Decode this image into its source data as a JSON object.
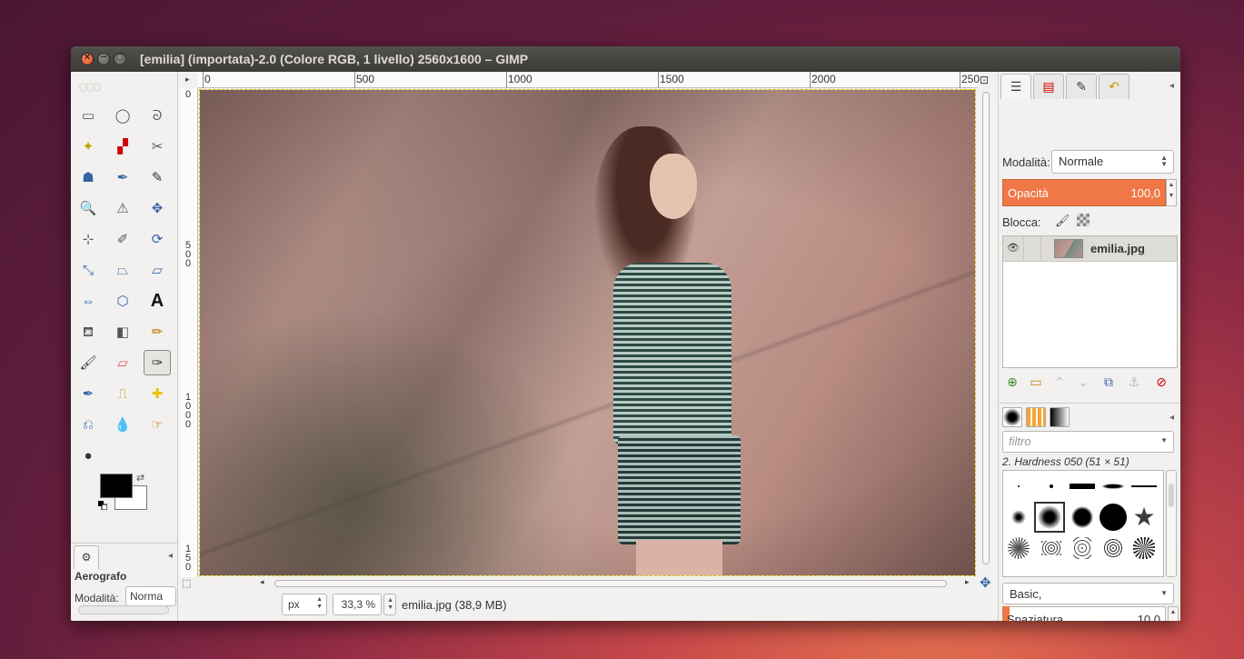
{
  "window": {
    "title": "[emilia] (importata)-2.0 (Colore RGB, 1 livello) 2560x1600 – GIMP"
  },
  "toolbox": {
    "tools": [
      {
        "name": "rect-select-tool",
        "glyph": "▭"
      },
      {
        "name": "ellipse-select-tool",
        "glyph": "◯"
      },
      {
        "name": "free-select-tool",
        "glyph": "ᘐ"
      },
      {
        "name": "fuzzy-select-tool",
        "glyph": "✦"
      },
      {
        "name": "select-by-color-tool",
        "glyph": "▞"
      },
      {
        "name": "scissors-select-tool",
        "glyph": "✂"
      },
      {
        "name": "foreground-select-tool",
        "glyph": "☗"
      },
      {
        "name": "paths-tool",
        "glyph": "✒"
      },
      {
        "name": "color-picker-tool",
        "glyph": "✎"
      },
      {
        "name": "zoom-tool",
        "glyph": "🔍"
      },
      {
        "name": "measure-tool",
        "glyph": "⚠"
      },
      {
        "name": "move-tool",
        "glyph": "✥"
      },
      {
        "name": "align-tool",
        "glyph": "⊹"
      },
      {
        "name": "crop-tool",
        "glyph": "✐"
      },
      {
        "name": "rotate-tool",
        "glyph": "⟳"
      },
      {
        "name": "scale-tool",
        "glyph": "⤡"
      },
      {
        "name": "shear-tool",
        "glyph": "⏢"
      },
      {
        "name": "perspective-tool",
        "glyph": "⏥"
      },
      {
        "name": "flip-tool",
        "glyph": "⇔"
      },
      {
        "name": "cage-transform-tool",
        "glyph": "⬡"
      },
      {
        "name": "text-tool",
        "glyph": "A"
      },
      {
        "name": "bucket-fill-tool",
        "glyph": "⛾"
      },
      {
        "name": "blend-tool",
        "glyph": "◧"
      },
      {
        "name": "pencil-tool",
        "glyph": "✏"
      },
      {
        "name": "paintbrush-tool",
        "glyph": "🖌"
      },
      {
        "name": "eraser-tool",
        "glyph": "▱"
      },
      {
        "name": "airbrush-tool",
        "glyph": "✑"
      },
      {
        "name": "ink-tool",
        "glyph": "✒"
      },
      {
        "name": "clone-tool",
        "glyph": "⎍"
      },
      {
        "name": "heal-tool",
        "glyph": "✚"
      },
      {
        "name": "perspective-clone-tool",
        "glyph": "⎌"
      },
      {
        "name": "blur-sharpen-tool",
        "glyph": "💧"
      },
      {
        "name": "smudge-tool",
        "glyph": "☞"
      },
      {
        "name": "dodge-burn-tool",
        "glyph": "●"
      }
    ],
    "options_title": "Aerografo",
    "options_mode_label": "Modalità:",
    "options_mode_value": "Norma"
  },
  "canvas": {
    "ruler_h": [
      "0",
      "500",
      "1000",
      "1500",
      "2000",
      "250"
    ],
    "ruler_v": [
      "0",
      "500",
      "1000",
      "150"
    ],
    "unit": "px",
    "zoom": "33,3 %",
    "file_info": "emilia.jpg (38,9 MB)"
  },
  "layers": {
    "mode_label": "Modalità:",
    "mode_value": "Normale",
    "opacity_label": "Opacità",
    "opacity_value": "100,0",
    "lock_label": "Blocca:",
    "layer_name": "emilia.jpg"
  },
  "brushes": {
    "filter_placeholder": "filtro",
    "selected_brush": "2. Hardness 050 (51 × 51)",
    "preset": "Basic,",
    "spacing_label": "Spaziatura",
    "spacing_value": "10,0"
  },
  "colors": {
    "accent": "#f07746",
    "foreground": "#000000",
    "background": "#ffffff"
  }
}
